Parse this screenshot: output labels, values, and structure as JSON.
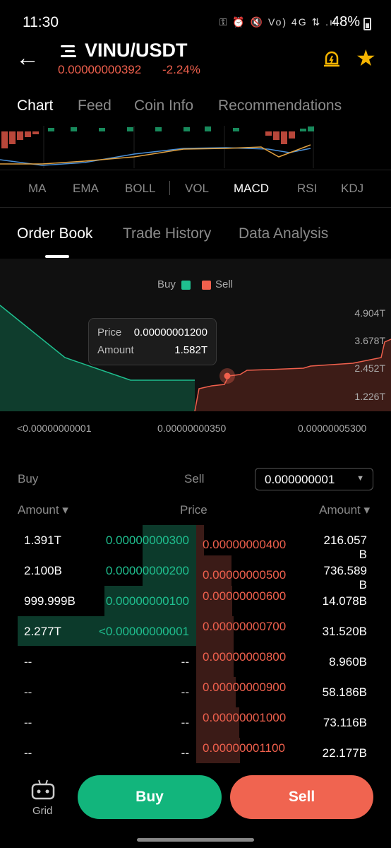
{
  "status_bar": {
    "time": "11:30",
    "icons": "⚿ ⏰ 🔇 Vo) 4G ⇅ .ıl",
    "battery": "48%"
  },
  "header": {
    "pair": "VINU/USDT",
    "price": "0.00000000392",
    "change": "-2.24%"
  },
  "tabs": [
    "Chart",
    "Feed",
    "Coin Info",
    "Recommendations"
  ],
  "indicators": [
    "MA",
    "EMA",
    "BOLL",
    "VOL",
    "MACD",
    "RSI",
    "KDJ"
  ],
  "order_tabs": [
    "Order Book",
    "Trade History",
    "Data Analysis"
  ],
  "depth": {
    "legend_buy": "Buy",
    "legend_sell": "Sell",
    "y_ticks": [
      "4.904T",
      "3.678T",
      "2.452T",
      "1.226T"
    ],
    "x_ticks": [
      "<0.00000000001",
      "0.00000000350",
      "0.00000005300"
    ],
    "tooltip": {
      "price_label": "Price",
      "price_value": "0.00000001200",
      "amount_label": "Amount",
      "amount_value": "1.582T"
    }
  },
  "book": {
    "buy_label": "Buy",
    "sell_label": "Sell",
    "precision": "0.000000001",
    "col_amount_left": "Amount ▾",
    "col_price": "Price",
    "col_amount_right": "Amount ▾",
    "rows": [
      {
        "bamt": "1.391T",
        "bprice": "0.00000000300",
        "sprice": "0.00000000400",
        "samt": "216.057\nB"
      },
      {
        "bamt": "2.100B",
        "bprice": "0.00000000200",
        "sprice": "0.00000000500",
        "samt": "736.589\nB"
      },
      {
        "bamt": "999.999B",
        "bprice": "0.00000000100",
        "sprice": "0.00000000600",
        "samt": "14.078B"
      },
      {
        "bamt": "2.277T",
        "bprice": "<0.00000000001",
        "sprice": "0.00000000700",
        "samt": "31.520B"
      },
      {
        "bamt": "--",
        "bprice": "--",
        "sprice": "0.00000000800",
        "samt": "8.960B"
      },
      {
        "bamt": "--",
        "bprice": "--",
        "sprice": "0.00000000900",
        "samt": "58.186B"
      },
      {
        "bamt": "--",
        "bprice": "--",
        "sprice": "0.00000001000",
        "samt": "73.116B"
      },
      {
        "bamt": "--",
        "bprice": "--",
        "sprice": "0.00000001100",
        "samt": "22.177B"
      }
    ]
  },
  "bottom": {
    "grid_label": "Grid",
    "buy": "Buy",
    "sell": "Sell"
  },
  "colors": {
    "buy": "#12b57c",
    "sell": "#f06450",
    "accent_star": "#f5b400"
  }
}
